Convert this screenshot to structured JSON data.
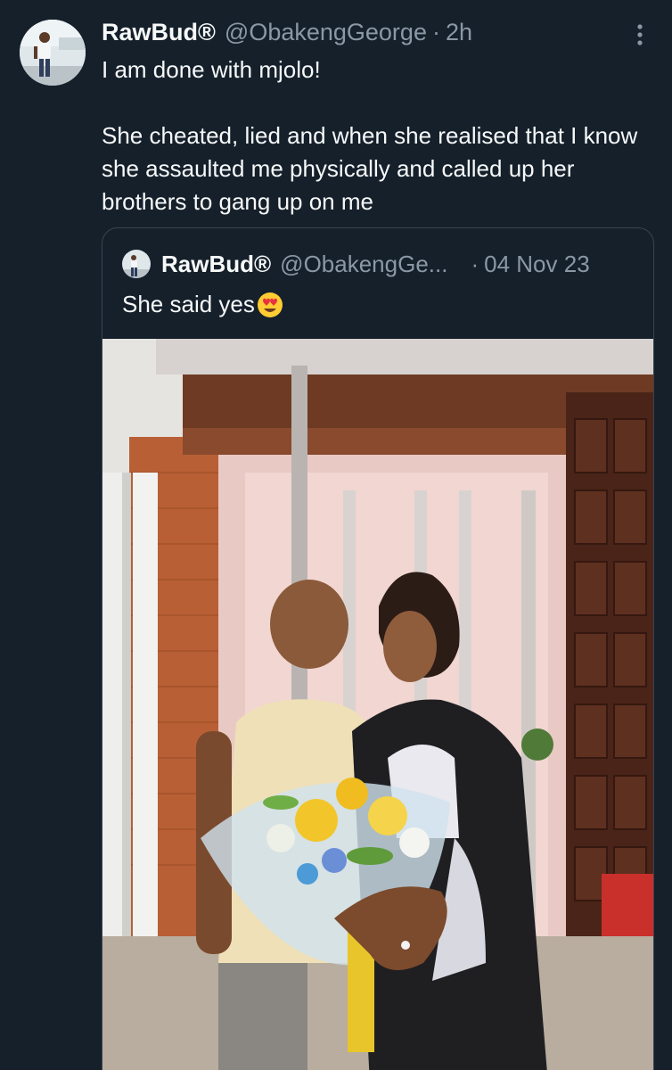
{
  "tweet": {
    "author_name": "RawBud®",
    "author_handle": "@ObakengGeorge",
    "separator": "·",
    "time": "2h",
    "text_line1": "I am done with mjolo!",
    "text_line2": "She cheated, lied and when she realised that I know she assaulted me physically and called up her brothers to gang up on me"
  },
  "quoted_tweet": {
    "author_name": "RawBud®",
    "author_handle": "@ObakengGe...",
    "separator": "·",
    "date": "04 Nov 23",
    "text": "She said yes",
    "emoji": "smiling-face-with-heart-eyes"
  },
  "icons": {
    "more": "more-vertical-icon"
  },
  "colors": {
    "background": "#15202b",
    "primary_text": "#f7f9f9",
    "secondary_text": "#8b98a5",
    "border": "#38444d"
  }
}
